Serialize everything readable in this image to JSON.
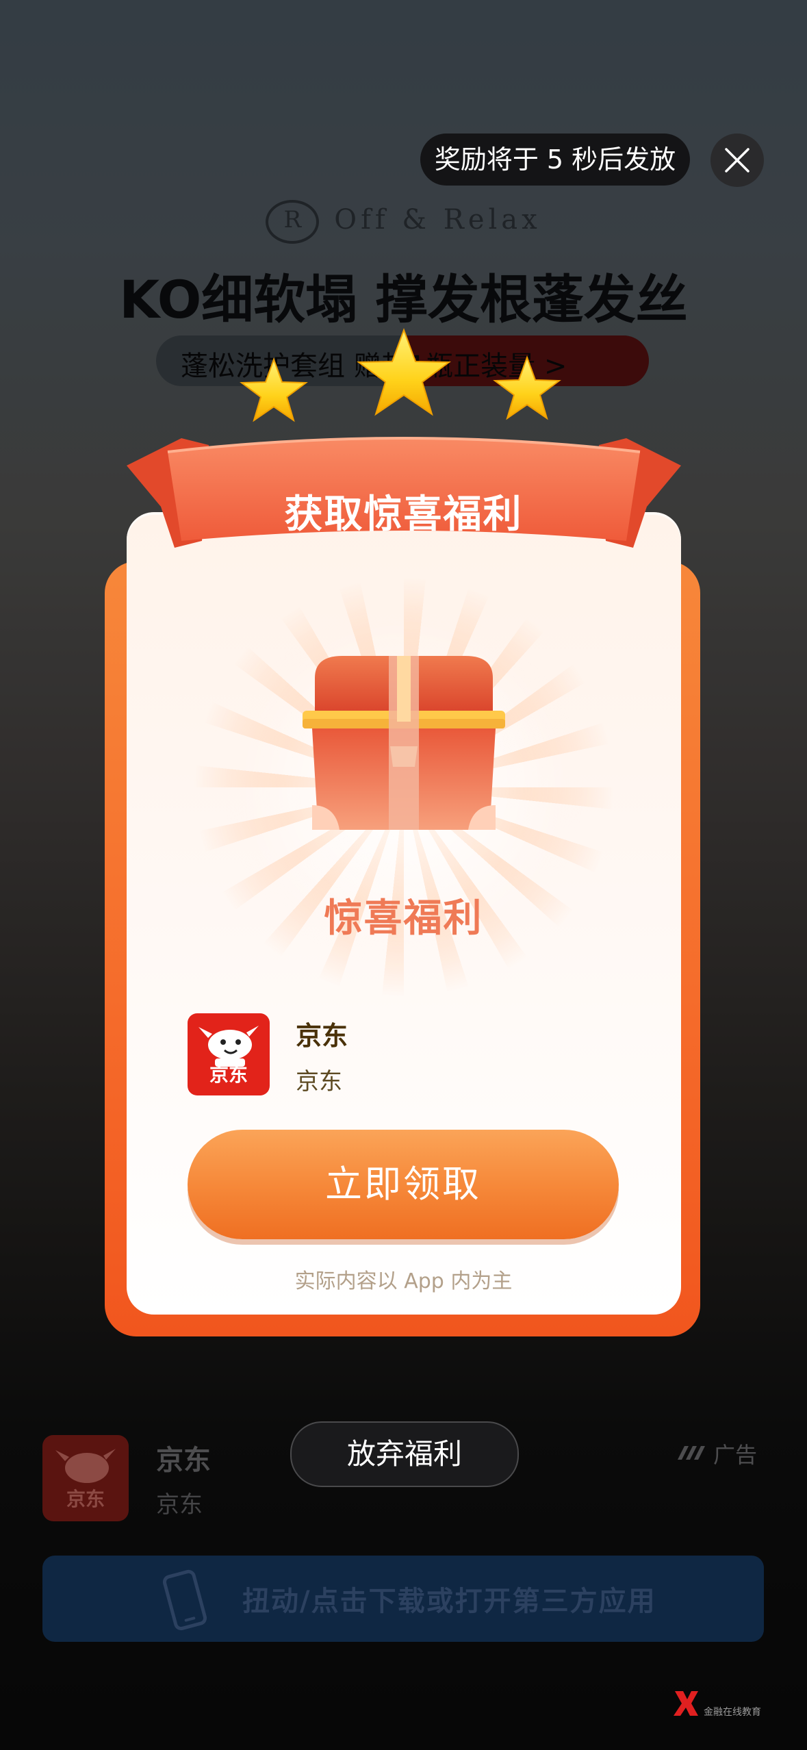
{
  "background_ad": {
    "brand": "Off & Relax",
    "brand_mark": "R",
    "headline": "KO细软塌 撑发根蓬发丝",
    "pill_text": "蓬松洗护套组 赠超1瓶正装量 >"
  },
  "top_bar": {
    "countdown_text": "奖励将于 5 秒后发放"
  },
  "modal": {
    "ribbon_title": "获取惊喜福利",
    "prize_label": "惊喜福利",
    "app": {
      "icon_text": "京东",
      "name": "京东",
      "subtitle": "京东"
    },
    "claim_button": "立即领取",
    "disclaimer": "实际内容以 App 内为主"
  },
  "give_up_button": "放弃福利",
  "bottom_ad": {
    "icon_text": "京东",
    "title": "京东",
    "subtitle": "京东",
    "ad_tag": "广告",
    "download_text": "扭动/点击下载或打开第三方应用"
  },
  "watermark": {
    "text": "金融在线教育"
  },
  "colors": {
    "accent_orange": "#f6893a",
    "card_orange": "#f56a2a",
    "prize_text": "#ef7a56",
    "jd_red": "#e2231a"
  }
}
